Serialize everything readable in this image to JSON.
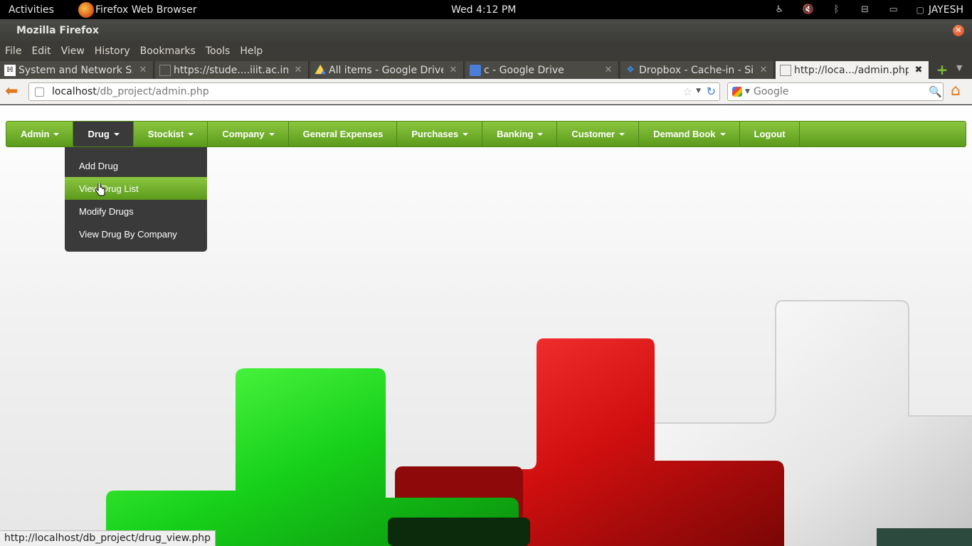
{
  "panel": {
    "activities": "Activities",
    "app_name": "Firefox Web Browser",
    "clock": "Wed  4:12 PM",
    "user": "JAYESH"
  },
  "window": {
    "title": "Mozilla Firefox"
  },
  "menu": {
    "file": "File",
    "edit": "Edit",
    "view": "View",
    "history": "History",
    "bookmarks": "Bookmarks",
    "tools": "Tools",
    "help": "Help"
  },
  "tabs": [
    {
      "label": "System and Network S..."
    },
    {
      "label": "https://stude....iiit.ac.in/"
    },
    {
      "label": "All items - Google Drive"
    },
    {
      "label": "c - Google Drive"
    },
    {
      "label": "Dropbox - Cache-in - Si..."
    },
    {
      "label": "http://loca.../admin.php"
    }
  ],
  "nav": {
    "url_host": "localhost",
    "url_path": "/db_project/admin.php",
    "search_placeholder": "Google"
  },
  "site": {
    "menu": [
      "Admin",
      "Drug",
      "Stockist",
      "Company",
      "General Expenses",
      "Purchases",
      "Banking",
      "Customer",
      "Demand Book",
      "Logout"
    ],
    "drug_dropdown": [
      "Add Drug",
      "View Drug List",
      "Modify Drugs",
      "View Drug By Company"
    ]
  },
  "status_url": "http://localhost/db_project/drug_view.php",
  "colors": {
    "nav_green": "#6aab2a",
    "dropdown_bg": "#3a3a3a",
    "accent_orange": "#e07820"
  }
}
